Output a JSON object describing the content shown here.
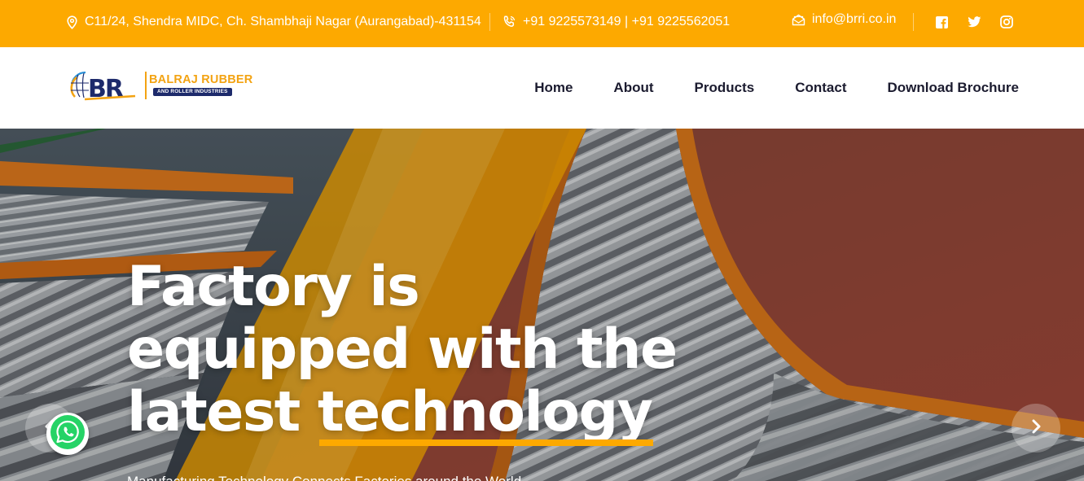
{
  "topbar": {
    "address": "C11/24, Shendra MIDC, Ch. Shambhaji Nagar (Aurangabad)-431154",
    "phones": "+91 9225573149 | +91 9225562051",
    "email": "info@brri.co.in",
    "address_icon": "map-pin-icon",
    "phone_icon": "phone-icon",
    "email_icon": "envelope-icon",
    "social": [
      "facebook-icon",
      "twitter-icon",
      "instagram-icon"
    ],
    "background": "#fda900"
  },
  "header": {
    "logo": {
      "mark": "BR",
      "brand": "BALRAJ RUBBER",
      "tagline": "AND ROLLER INDUSTRIES"
    },
    "nav": [
      "Home",
      "About",
      "Products",
      "Contact",
      "Download Brochure"
    ]
  },
  "hero": {
    "headline_line1": "Factory is",
    "headline_line2": "equipped with the",
    "headline_line3_part1": "latest ",
    "headline_line3_highlight": "technology",
    "subline": "Manufacturing Technology Connects Factories around the World",
    "accent": "#fda900",
    "prev_icon": "chevron-left-icon",
    "next_icon": "chevron-right-icon",
    "chat_icon": "whatsapp-icon"
  }
}
